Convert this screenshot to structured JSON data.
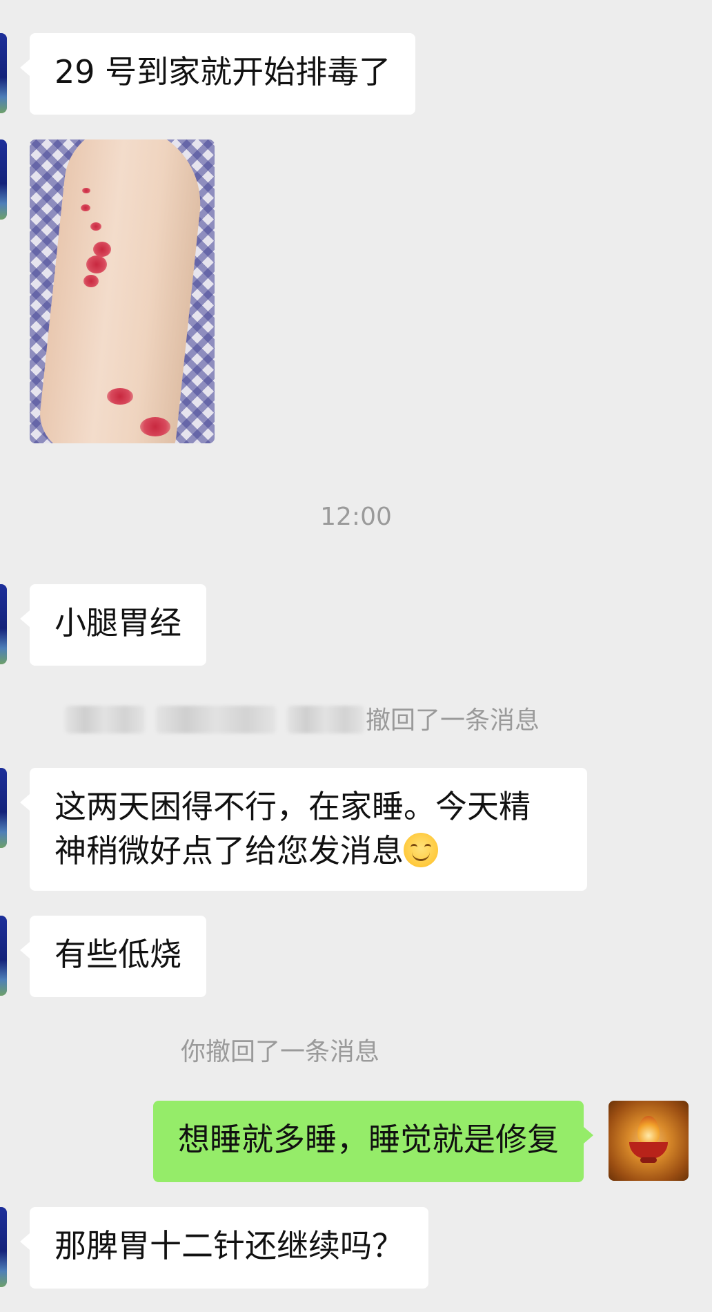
{
  "messages": {
    "m1": "29 号到家就开始排毒了",
    "m3": "小腿胃经",
    "m4": "这两天困得不行，在家睡。今天精",
    "m4b": "神稍微好点了给您发消息",
    "m5": "有些低烧",
    "m6": "想睡就多睡，睡觉就是修复",
    "m7": "那脾胃十二针还继续吗？"
  },
  "system": {
    "time": "12:00",
    "recall_other": "撤回了一条消息",
    "recall_self": "你撤回了一条消息"
  },
  "icons": {
    "emoji": "smiling-face-icon"
  }
}
